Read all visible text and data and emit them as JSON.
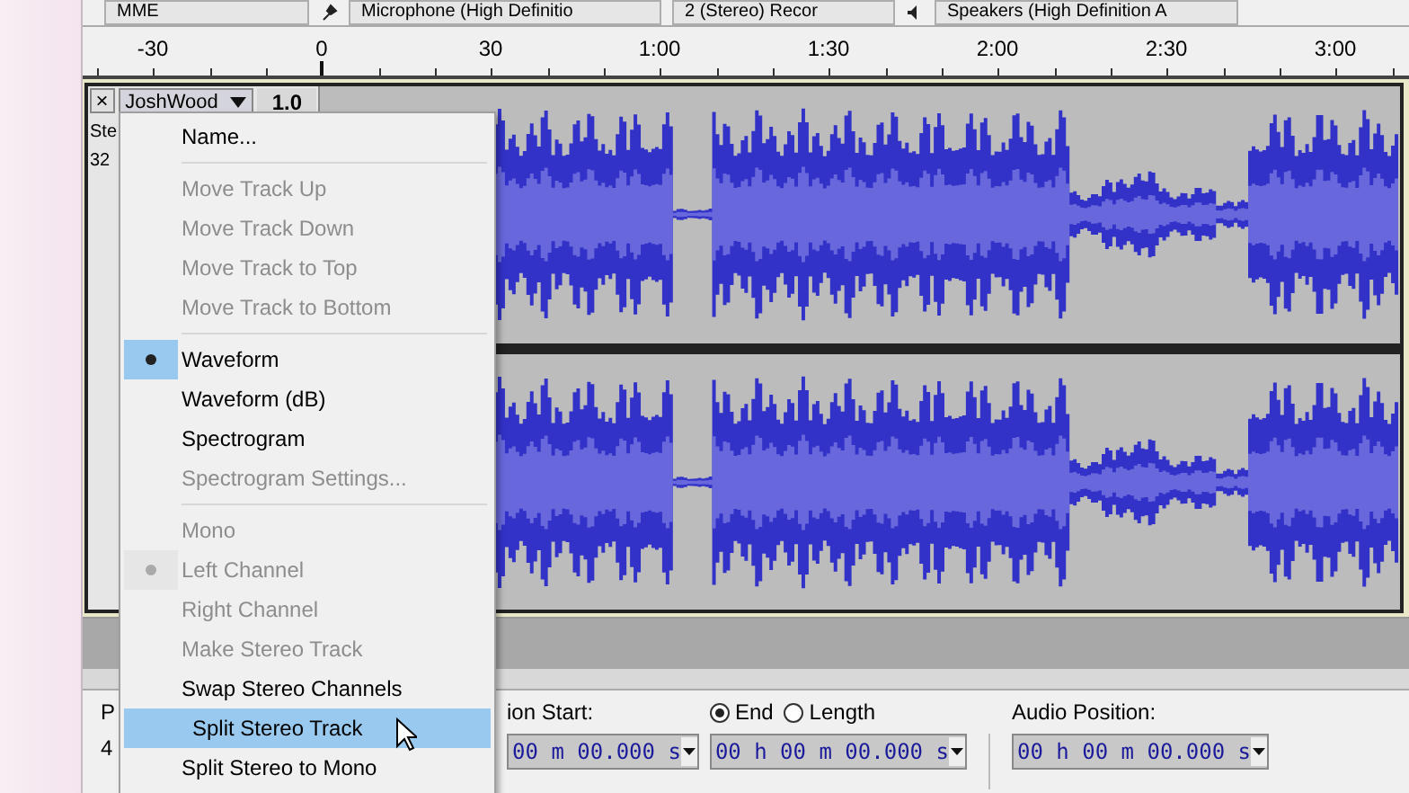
{
  "toolbar": {
    "host": "MME",
    "recording_device": "Microphone (High Definitio",
    "recording_channels": "2 (Stereo) Recor",
    "playback_device": "Speakers (High Definition A"
  },
  "ruler": {
    "labels": [
      "-30",
      "0",
      "30",
      "1:00",
      "1:30",
      "2:00",
      "2:30",
      "3:00"
    ]
  },
  "track": {
    "close_label": "×",
    "name": "JoshWood",
    "gain": "1.0",
    "info": [
      "Ste",
      "32"
    ]
  },
  "track_menu": {
    "items": [
      {
        "kind": "item",
        "label": "Name...",
        "disabled": false,
        "checked": false,
        "selected": false
      },
      {
        "kind": "separator"
      },
      {
        "kind": "item",
        "label": "Move Track Up",
        "disabled": true,
        "checked": false,
        "selected": false
      },
      {
        "kind": "item",
        "label": "Move Track Down",
        "disabled": true,
        "checked": false,
        "selected": false
      },
      {
        "kind": "item",
        "label": "Move Track to Top",
        "disabled": true,
        "checked": false,
        "selected": false
      },
      {
        "kind": "item",
        "label": "Move Track to Bottom",
        "disabled": true,
        "checked": false,
        "selected": false
      },
      {
        "kind": "separator"
      },
      {
        "kind": "item",
        "label": "Waveform",
        "disabled": false,
        "checked": true,
        "selected": false
      },
      {
        "kind": "item",
        "label": "Waveform (dB)",
        "disabled": false,
        "checked": false,
        "selected": false
      },
      {
        "kind": "item",
        "label": "Spectrogram",
        "disabled": false,
        "checked": false,
        "selected": false
      },
      {
        "kind": "item",
        "label": "Spectrogram Settings...",
        "disabled": true,
        "checked": false,
        "selected": false
      },
      {
        "kind": "separator"
      },
      {
        "kind": "item",
        "label": "Mono",
        "disabled": true,
        "checked": false,
        "selected": false
      },
      {
        "kind": "item",
        "label": "Left Channel",
        "disabled": true,
        "checked": true,
        "selected": false
      },
      {
        "kind": "item",
        "label": "Right Channel",
        "disabled": true,
        "checked": false,
        "selected": false
      },
      {
        "kind": "item",
        "label": "Make Stereo Track",
        "disabled": true,
        "checked": false,
        "selected": false
      },
      {
        "kind": "item",
        "label": "Swap Stereo Channels",
        "disabled": false,
        "checked": false,
        "selected": false
      },
      {
        "kind": "item",
        "label": "Split Stereo Track",
        "disabled": false,
        "checked": false,
        "selected": true
      },
      {
        "kind": "item",
        "label": "Split Stereo to Mono",
        "disabled": false,
        "checked": false,
        "selected": false
      }
    ]
  },
  "selection_toolbar": {
    "left_label": "P",
    "left_value": "4",
    "start_label": "ion Start:",
    "start_value": "00 m 00.000 s",
    "end_options": [
      {
        "label": "End",
        "selected": true
      },
      {
        "label": "Length",
        "selected": false
      }
    ],
    "end_value": "00 h 00 m 00.000 s",
    "position_label": "Audio Position:",
    "position_value": "00 h 00 m 00.000 s"
  }
}
